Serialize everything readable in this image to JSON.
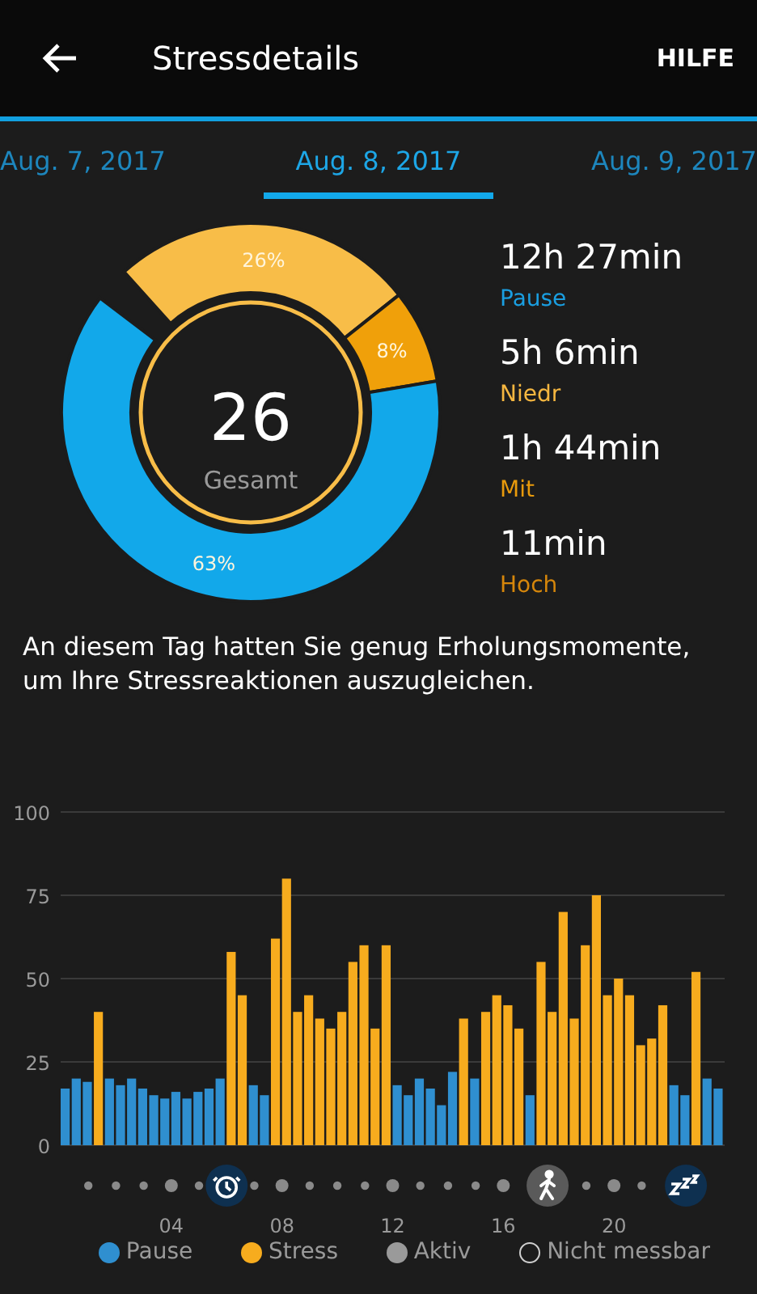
{
  "header": {
    "title": "Stressdetails",
    "help": "HILFE"
  },
  "tabs": [
    {
      "label": "Aug. 7, 2017",
      "selected": false
    },
    {
      "label": "Aug. 8, 2017",
      "selected": true
    },
    {
      "label": "Aug. 9, 2017",
      "selected": false
    }
  ],
  "summary": {
    "score": "26",
    "score_label": "Gesamt",
    "chart_data": {
      "type": "donut",
      "values": [
        26,
        8,
        63
      ],
      "colors": [
        "#f8bd48",
        "#f0a00a",
        "#12a8ea"
      ],
      "value_labels": [
        "26%",
        "8%",
        "63%"
      ]
    }
  },
  "stats": [
    {
      "value": "12h 27min",
      "label": "Pause",
      "color": "#1a9ee0"
    },
    {
      "value": "5h 6min",
      "label": "Niedr",
      "color": "#f5b640"
    },
    {
      "value": "1h 44min",
      "label": "Mit",
      "color": "#e89a0c"
    },
    {
      "value": "11min",
      "label": "Hoch",
      "color": "#d5860b"
    }
  ],
  "message": "An diesem Tag hatten Sie genug Erholungsmomente, um Ihre Stressreaktionen auszugleichen.",
  "timeline": {
    "chart_data": {
      "type": "bar",
      "stacked": false,
      "grid": true,
      "xlim": [
        0,
        24
      ],
      "ylim": [
        0,
        100
      ],
      "yticks": [
        0,
        25,
        50,
        75,
        100
      ],
      "xticks": [
        {
          "value": 4,
          "label": "04"
        },
        {
          "value": 8,
          "label": "08"
        },
        {
          "value": 12,
          "label": "12"
        },
        {
          "value": 16,
          "label": "16"
        },
        {
          "value": 20,
          "label": "20"
        }
      ],
      "x": [
        0,
        0.4,
        0.8,
        1.2,
        1.6,
        2,
        2.4,
        2.8,
        3.2,
        3.6,
        4,
        4.4,
        4.8,
        5.2,
        5.6,
        6,
        6.4,
        6.8,
        7.2,
        7.6,
        8,
        8.4,
        8.8,
        9.2,
        9.6,
        10,
        10.4,
        10.8,
        11.2,
        11.6,
        12,
        12.4,
        12.8,
        13.2,
        13.6,
        14,
        14.4,
        14.8,
        15.2,
        15.6,
        16,
        16.4,
        16.8,
        17.2,
        17.6,
        18,
        18.4,
        18.8,
        19.2,
        19.6,
        20,
        20.4,
        20.8,
        21.2,
        21.6,
        22,
        22.4,
        22.8,
        23.2,
        23.6
      ],
      "series": [
        {
          "color": "#2f8fd0",
          "values": [
            17,
            20,
            19,
            null,
            20,
            18,
            20,
            17,
            15,
            14,
            16,
            14,
            16,
            17,
            20,
            null,
            null,
            18,
            15,
            null,
            null,
            null,
            null,
            null,
            null,
            null,
            null,
            null,
            null,
            null,
            18,
            15,
            20,
            17,
            12,
            22,
            null,
            20,
            null,
            null,
            null,
            null,
            15,
            null,
            null,
            null,
            null,
            null,
            null,
            null,
            null,
            null,
            null,
            null,
            null,
            18,
            15,
            null,
            20,
            17
          ]
        },
        {
          "color": "#f7ac1e",
          "values": [
            null,
            null,
            null,
            40,
            null,
            null,
            null,
            null,
            null,
            null,
            null,
            null,
            null,
            null,
            null,
            58,
            45,
            null,
            null,
            62,
            80,
            40,
            45,
            38,
            35,
            40,
            55,
            60,
            35,
            60,
            null,
            null,
            null,
            null,
            null,
            null,
            38,
            null,
            40,
            45,
            42,
            35,
            null,
            55,
            40,
            70,
            38,
            60,
            75,
            45,
            50,
            45,
            30,
            32,
            42,
            null,
            null,
            52,
            null,
            null
          ]
        }
      ]
    }
  },
  "markers": [
    {
      "kind": "alarm"
    },
    {
      "kind": "walk"
    },
    {
      "kind": "sleep"
    }
  ],
  "legend": [
    {
      "label": "Pause",
      "kind": "filled",
      "color": "#2f8fd0"
    },
    {
      "label": "Stress",
      "kind": "filled",
      "color": "#f7ac1e"
    },
    {
      "label": "Aktiv",
      "kind": "filled",
      "color": "#9a9a9a"
    },
    {
      "label": "Nicht messbar",
      "kind": "outline",
      "color": "#cfcfcf"
    }
  ]
}
